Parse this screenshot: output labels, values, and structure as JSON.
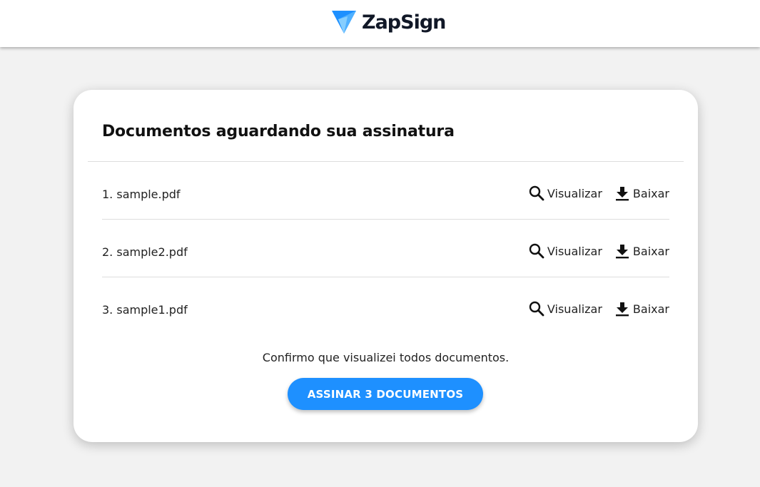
{
  "header": {
    "brand_name": "ZapSign",
    "brand_colors": {
      "logo_primary": "#1e90ff",
      "logo_secondary": "#6ec6ff",
      "text": "#111827"
    }
  },
  "card": {
    "title": "Documentos aguardando sua assinatura",
    "documents": [
      {
        "name": "1. sample.pdf",
        "view_label": "Visualizar",
        "download_label": "Baixar"
      },
      {
        "name": "2. sample2.pdf",
        "view_label": "Visualizar",
        "download_label": "Baixar"
      },
      {
        "name": "3. sample1.pdf",
        "view_label": "Visualizar",
        "download_label": "Baixar"
      }
    ],
    "icons": {
      "view": "search-icon",
      "download": "download-icon"
    },
    "confirm_text": "Confirmo que visualizei todos documentos.",
    "sign_button_label": "ASSINAR 3 DOCUMENTOS",
    "accent_color": "#1e90ff"
  }
}
